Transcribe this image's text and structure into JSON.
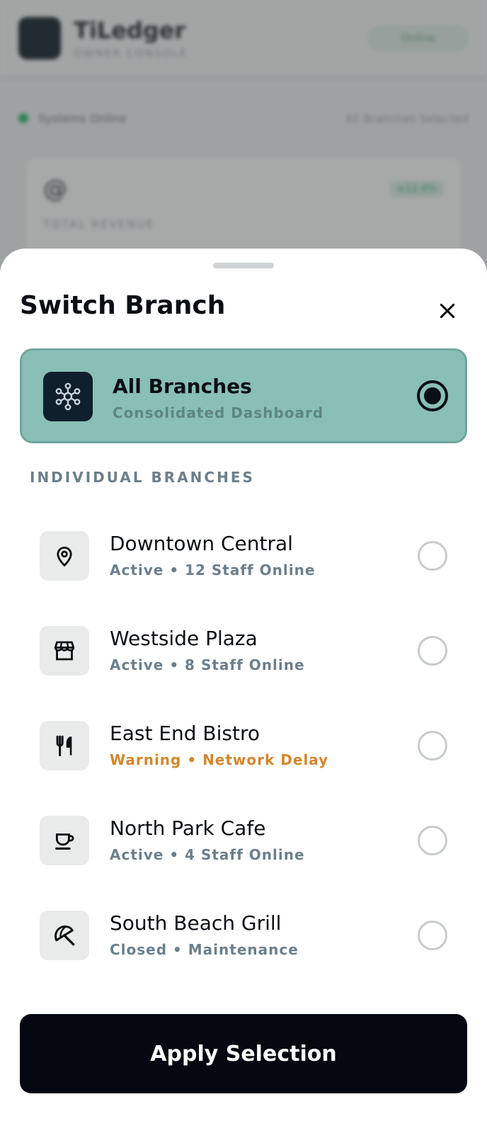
{
  "background": {
    "app_title": "TiLedger",
    "app_subtitle": "OWNER CONSOLE",
    "header_pill": "Online",
    "status_text": "Systems Online",
    "status_right": "All Branches Selected",
    "card_icon": "@",
    "card_badge": "+12.4%",
    "card_label": "TOTAL REVENUE"
  },
  "sheet": {
    "title": "Switch Branch",
    "close_icon": "close-icon",
    "all_branches": {
      "name": "All Branches",
      "subtitle": "Consolidated Dashboard",
      "icon": "network-hub-icon",
      "selected": true
    },
    "section_label": "INDIVIDUAL BRANCHES",
    "branches": [
      {
        "name": "Downtown Central",
        "status": "Active • 12 Staff Online",
        "icon": "map-pin-icon",
        "state": "active",
        "selected": false
      },
      {
        "name": "Westside Plaza",
        "status": "Active • 8 Staff Online",
        "icon": "storefront-icon",
        "state": "active",
        "selected": false
      },
      {
        "name": "East End Bistro",
        "status": "Warning • Network Delay",
        "icon": "utensils-icon",
        "state": "warning",
        "selected": false
      },
      {
        "name": "North Park Cafe",
        "status": "Active • 4 Staff Online",
        "icon": "coffee-cup-icon",
        "state": "active",
        "selected": false
      },
      {
        "name": "South Beach Grill",
        "status": "Closed • Maintenance",
        "icon": "umbrella-icon",
        "state": "closed",
        "selected": false
      }
    ],
    "apply_label": "Apply Selection"
  },
  "colors": {
    "selected_card_bg": "#89bfb6",
    "selected_card_border": "#6fa69b",
    "warning": "#d4862c",
    "muted": "#6b7f8c",
    "primary_button": "#050810"
  }
}
